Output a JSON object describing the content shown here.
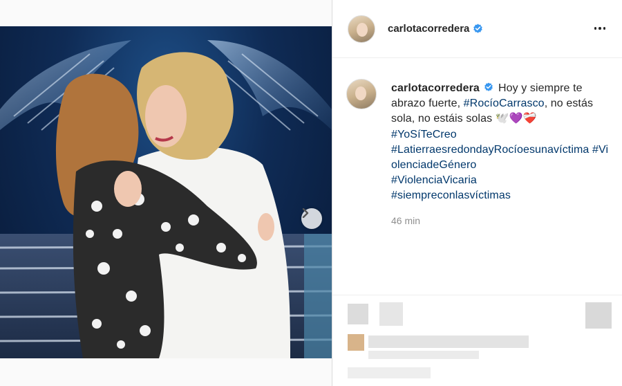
{
  "post": {
    "username": "carlotacorredera",
    "verified": true,
    "caption": {
      "text_1": "Hoy y siempre te abrazo fuerte, ",
      "tag_1": "#RocíoCarrasco",
      "text_2": ", no estás sola, no estáis solas 🕊️💜❤️‍🩹",
      "tag_2": "#YoSíTeCreo",
      "tag_3": "#LatierraesredondayRocíoesunavíctima",
      "tag_4": "#ViolenciadeGénero",
      "tag_5": "#ViolenciaVicaria",
      "tag_6": "#siempreconlasvíctimas"
    },
    "time": "46 min"
  },
  "icons": {
    "more": "more-options-icon",
    "verified": "verified-badge-icon",
    "next": "chevron-right-icon"
  },
  "colors": {
    "link": "#00376b",
    "verified": "#3897f0",
    "muted": "#8e8e8e"
  }
}
